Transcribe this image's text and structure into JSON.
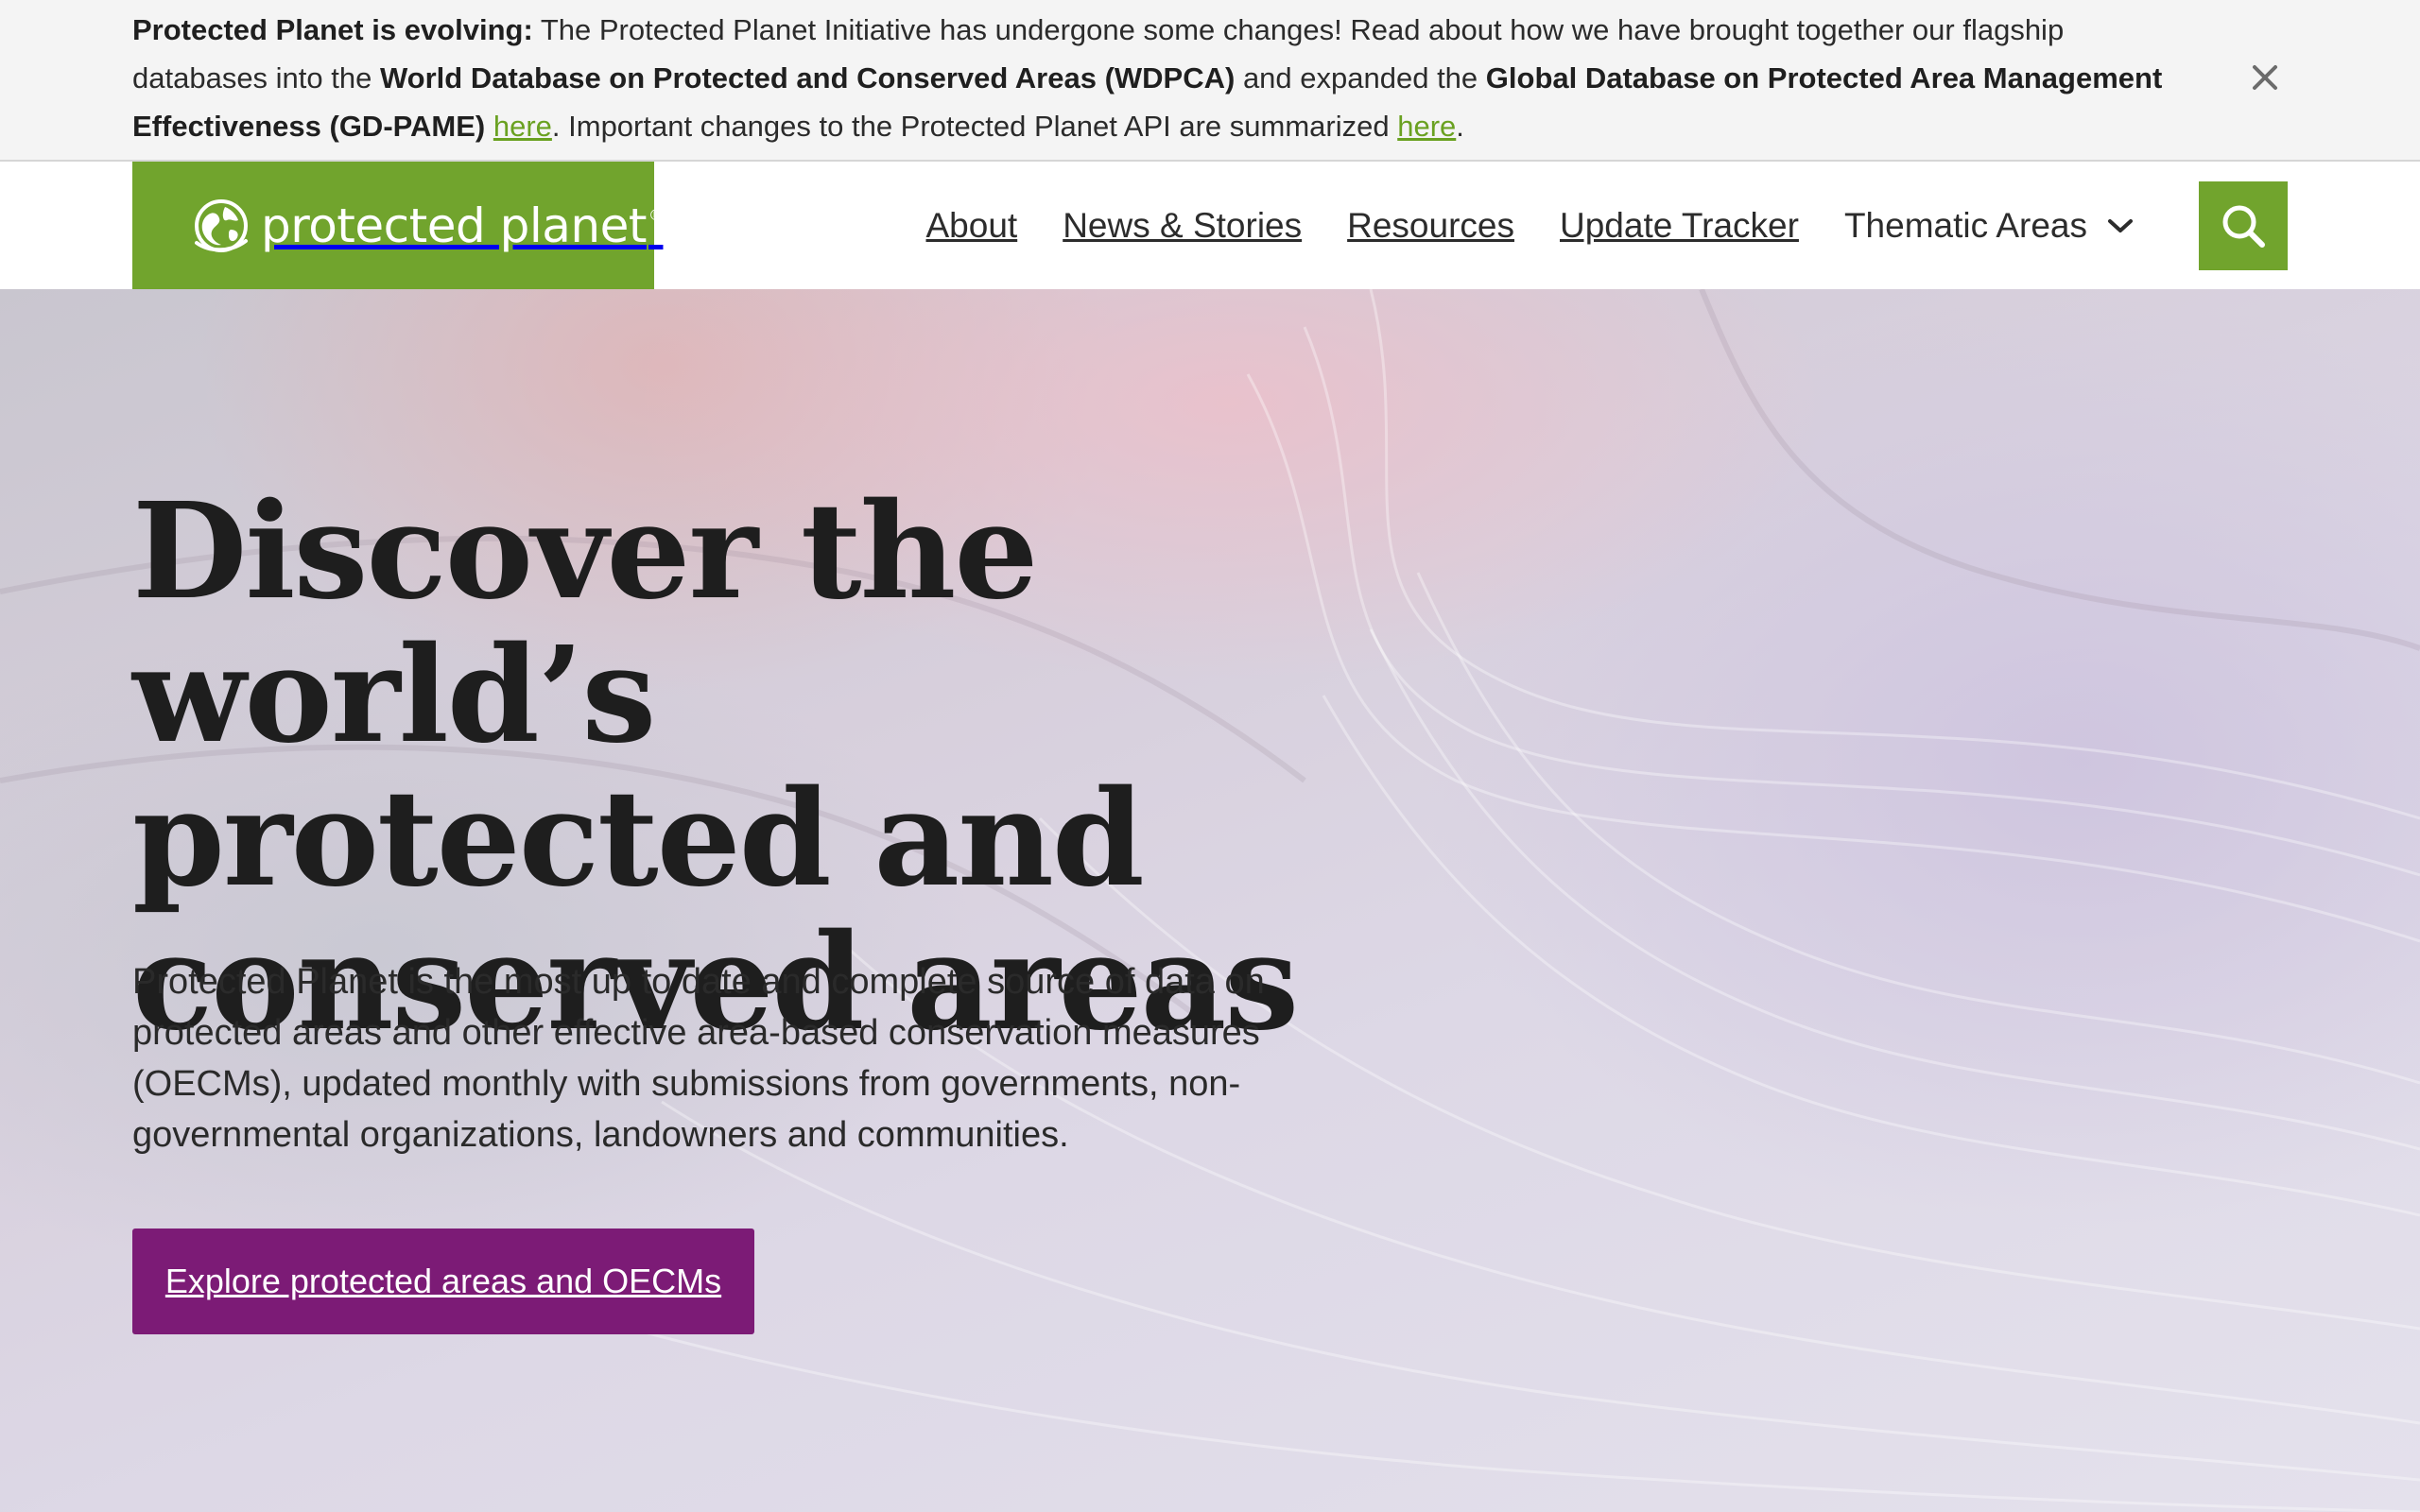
{
  "banner": {
    "lead": "Protected Planet is evolving:",
    "text_1": " The Protected Planet Initiative has undergone some changes! Read about how we have brought together our flagship databases into the ",
    "wdpca": "World Database on Protected and Conserved Areas (WDPCA)",
    "text_2": " and expanded the ",
    "gdpame": "Global Database on Protected Area Management Effectiveness (GD-PAME)",
    "text_3": " ",
    "link_1": "here",
    "text_4": ". Important changes to the Protected Planet API are summarized ",
    "link_2": "here",
    "text_5": ".",
    "close_icon": "close-icon"
  },
  "header": {
    "logo_text": "protected planet",
    "logo_mark": "®",
    "nav": {
      "about": "About",
      "news": "News & Stories",
      "resources": "Resources",
      "update_tracker": "Update Tracker",
      "thematic_areas": "Thematic Areas"
    },
    "search_icon": "search-icon"
  },
  "hero": {
    "title_line_1": "Discover the world’s",
    "title_line_2": "protected and",
    "title_line_3": "conserved areas",
    "description": "Protected Planet is the most up to date and complete source of data on protected areas and other effective area-based conservation measures (OECMs), updated monthly with submissions from governments, non-governmental organizations, landowners and communities.",
    "cta_label": "Explore protected areas and OECMs"
  },
  "colors": {
    "brand_green": "#71a42d",
    "link_green": "#6aa121",
    "cta_purple": "#7c1b76",
    "banner_bg": "#f4f4f4"
  }
}
